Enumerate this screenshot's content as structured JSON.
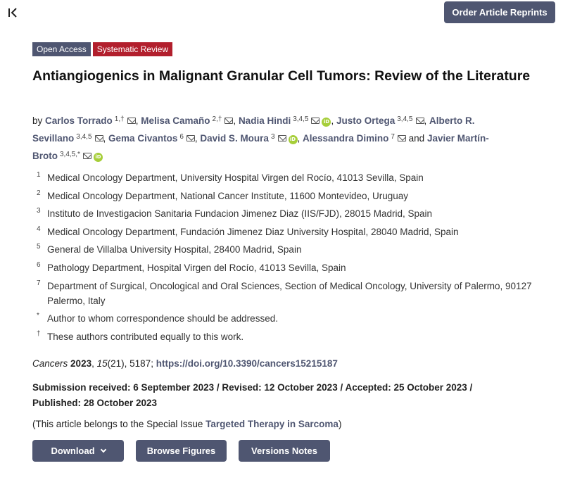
{
  "header": {
    "collapse_icon": "collapse-left-icon",
    "order_reprints_label": "Order Article Reprints"
  },
  "badges": {
    "open_access": "Open Access",
    "article_type": "Systematic Review"
  },
  "article": {
    "title": "Antiangiogenics in Malignant Granular Cell Tumors: Review of the Literature",
    "by": "by",
    "and": "and"
  },
  "authors": [
    {
      "name": "Carlos Torrado",
      "sup": "1,†",
      "orcid": false
    },
    {
      "name": "Melisa Camaño",
      "sup": "2,†",
      "orcid": false
    },
    {
      "name": "Nadia Hindi",
      "sup": "3,4,5",
      "orcid": true
    },
    {
      "name": "Justo Ortega",
      "sup": "3,4,5",
      "orcid": false
    },
    {
      "name": "Alberto R. Sevillano",
      "sup": "3,4,5",
      "orcid": false
    },
    {
      "name": "Gema Civantos",
      "sup": "6",
      "orcid": false
    },
    {
      "name": "David S. Moura",
      "sup": "3",
      "orcid": true
    },
    {
      "name": "Alessandra Dimino",
      "sup": "7",
      "orcid": false
    },
    {
      "name": "Javier Martín-Broto",
      "sup": "3,4,5,*",
      "orcid": true
    }
  ],
  "affiliations": [
    {
      "num": "1",
      "text": "Medical Oncology Department, University Hospital Virgen del Rocío, 41013 Sevilla, Spain"
    },
    {
      "num": "2",
      "text": "Medical Oncology Department, National Cancer Institute, 11600 Montevideo, Uruguay"
    },
    {
      "num": "3",
      "text": "Instituto de Investigacion Sanitaria Fundacion Jimenez Diaz (IIS/FJD), 28015 Madrid, Spain"
    },
    {
      "num": "4",
      "text": "Medical Oncology Department, Fundación Jimenez Diaz University Hospital, 28040 Madrid, Spain"
    },
    {
      "num": "5",
      "text": "General de Villalba University Hospital, 28400 Madrid, Spain"
    },
    {
      "num": "6",
      "text": "Pathology Department, Hospital Virgen del Rocío, 41013 Sevilla, Spain"
    },
    {
      "num": "7",
      "text": "Department of Surgical, Oncological and Oral Sciences, Section of Medical Oncology, University of Palermo, 90127 Palermo, Italy"
    },
    {
      "num": "*",
      "text": "Author to whom correspondence should be addressed."
    },
    {
      "num": "†",
      "text": "These authors contributed equally to this work."
    }
  ],
  "citation": {
    "journal": "Cancers",
    "year": "2023",
    "volume": "15",
    "issue": "(21)",
    "pages": ", 5187;",
    "doi": "https://doi.org/10.3390/cancers15215187"
  },
  "dates": {
    "text": "Submission received: 6 September 2023 / Revised: 12 October 2023 / Accepted: 25 October 2023 / Published: 28 October 2023"
  },
  "special_issue": {
    "prefix": "(This article belongs to the Special Issue ",
    "link": "Targeted Therapy in Sarcoma",
    "suffix": ")"
  },
  "actions": {
    "download_label": "Download",
    "browse_figures_label": "Browse Figures",
    "versions_notes_label": "Versions Notes"
  }
}
